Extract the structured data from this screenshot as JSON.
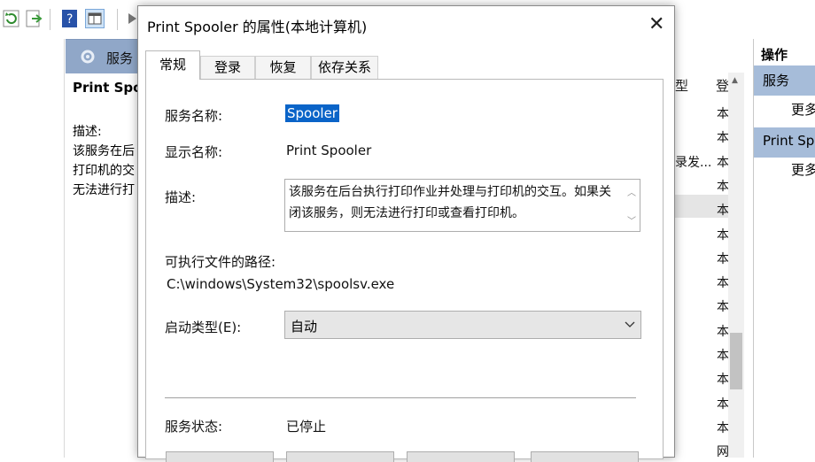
{
  "console": {
    "services_header": "服务",
    "detail_title": "Print Spo",
    "detail_desc_label": "描述:",
    "detail_desc_lines": [
      "该服务在后",
      "打印机的交",
      "无法进行打"
    ],
    "column_type": "型",
    "column_login": "登",
    "row_text_desc": "录发...",
    "row_values": [
      "本",
      "本",
      "本",
      "本",
      "本",
      "本",
      "本",
      "本",
      "本",
      "本",
      "本",
      "本",
      "本",
      "本",
      "网"
    ]
  },
  "actions": {
    "header": "操作",
    "section1": "服务",
    "more1": "更多",
    "section2": "Print Spo",
    "more2": "更多"
  },
  "dialog": {
    "title": "Print Spooler 的属性(本地计算机)",
    "tabs": [
      "常规",
      "登录",
      "恢复",
      "依存关系"
    ],
    "service_name_label": "服务名称:",
    "service_name": "Spooler",
    "display_name_label": "显示名称:",
    "display_name": "Print Spooler",
    "description_label": "描述:",
    "description": "该服务在后台执行打印作业并处理与打印机的交互。如果关闭该服务，则无法进行打印或查看打印机。",
    "exe_path_label": "可执行文件的路径:",
    "exe_path": "C:\\windows\\System32\\spoolsv.exe",
    "startup_type_label": "启动类型(E):",
    "startup_type": "自动",
    "service_status_label": "服务状态:",
    "service_status": "已停止"
  },
  "colors": {
    "selection": "#0a64c8",
    "header_blue": "#90a7c8",
    "action_blue": "#a6bcd9"
  }
}
